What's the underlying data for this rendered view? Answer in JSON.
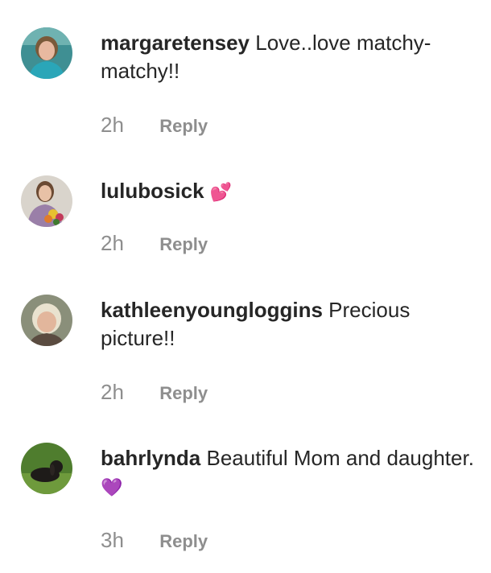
{
  "comments": [
    {
      "username": "margaretensey",
      "text": "Love..love matchy-matchy!!",
      "emoji": "",
      "time": "2h",
      "reply_label": "Reply",
      "avatar_colors": {
        "bg": "#3f8f93",
        "face": "#e8b9a0",
        "hair": "#7a5a3a",
        "shirt": "#2aa6b8"
      }
    },
    {
      "username": "lulubosick",
      "text": "",
      "emoji": "💕",
      "time": "2h",
      "reply_label": "Reply",
      "avatar_colors": {
        "bg": "#d9d4cc",
        "face": "#e8c1a6",
        "hair": "#6b4a33",
        "shirt": "#9a7fa8"
      }
    },
    {
      "username": "kathleenyoungloggins",
      "text": "Precious picture!!",
      "emoji": "",
      "time": "2h",
      "reply_label": "Reply",
      "avatar_colors": {
        "bg": "#8a8f7a",
        "face": "#e2b69c",
        "hair": "#e9e2cf",
        "shirt": "#5a4b40"
      }
    },
    {
      "username": "bahrlynda",
      "text": "Beautiful Mom and daughter.",
      "emoji": "💜",
      "time": "3h",
      "reply_label": "Reply",
      "avatar_colors": {
        "bg": "#4f7d2e",
        "dog": "#1e1b19",
        "grass": "#6e9a3c"
      }
    }
  ]
}
